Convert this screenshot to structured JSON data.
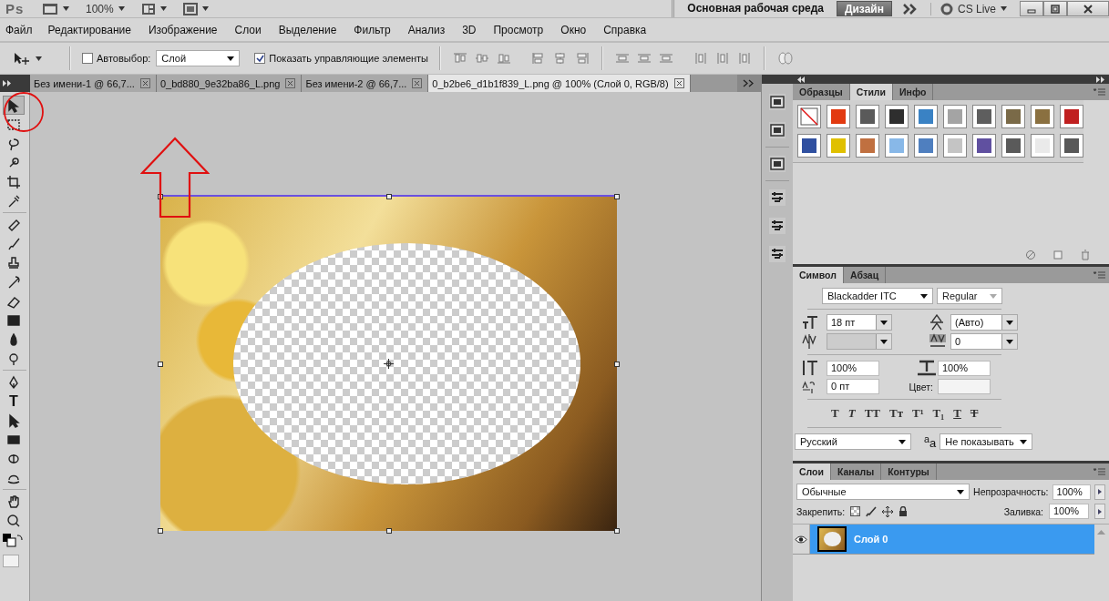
{
  "app_bar": {
    "logo": "Ps",
    "zoom": "100%",
    "workspace": "Основная рабочая среда",
    "design_button": "Дизайн",
    "cs_live": "CS Live"
  },
  "menu": [
    "Файл",
    "Редактирование",
    "Изображение",
    "Слои",
    "Выделение",
    "Фильтр",
    "Анализ",
    "3D",
    "Просмотр",
    "Окно",
    "Справка"
  ],
  "options_bar": {
    "auto_select": {
      "label": "Автовыбор:",
      "checked": false
    },
    "auto_select_target": "Слой",
    "show_controls": {
      "label": "Показать управляющие элементы",
      "checked": true
    }
  },
  "document_tabs": [
    {
      "label": "Без имени-1 @ 66,7...",
      "selected": false
    },
    {
      "label": "0_bd880_9e32ba86_L.png",
      "selected": false
    },
    {
      "label": "Без имени-2 @ 66,7...",
      "selected": false
    },
    {
      "label": "0_b2be6_d1b1f839_L.png @ 100% (Слой 0, RGB/8)",
      "selected": true
    }
  ],
  "tools": [
    {
      "kind": "move",
      "selected": true
    },
    {
      "kind": "marquee",
      "selected": false
    },
    {
      "kind": "lasso",
      "selected": false
    },
    {
      "kind": "quick-select",
      "selected": false
    },
    {
      "kind": "crop",
      "selected": false
    },
    {
      "kind": "eyedropper",
      "selected": false
    },
    {
      "kind": "healing",
      "selected": false
    },
    {
      "kind": "brush",
      "selected": false
    },
    {
      "kind": "stamp",
      "selected": false
    },
    {
      "kind": "history-brush",
      "selected": false
    },
    {
      "kind": "eraser",
      "selected": false
    },
    {
      "kind": "gradient",
      "selected": false
    },
    {
      "kind": "blur",
      "selected": false
    },
    {
      "kind": "dodge",
      "selected": false
    },
    {
      "kind": "pen",
      "selected": false
    },
    {
      "kind": "type",
      "selected": false,
      "glyph": "T"
    },
    {
      "kind": "path-select",
      "selected": false
    },
    {
      "kind": "rectangle",
      "selected": false
    },
    {
      "kind": "rotate-3d",
      "selected": false
    },
    {
      "kind": "orbit-3d",
      "selected": false
    },
    {
      "kind": "hand",
      "selected": false
    },
    {
      "kind": "zoom",
      "selected": false
    }
  ],
  "styles_panel": {
    "tabs": [
      {
        "label": "Образцы",
        "selected": false
      },
      {
        "label": "Стили",
        "selected": true
      },
      {
        "label": "Инфо",
        "selected": false
      }
    ],
    "swatches": [
      {
        "kind": "none"
      },
      {
        "kind": "fill",
        "color": "#e23a10"
      },
      {
        "kind": "fill",
        "color": "#5a5a5a"
      },
      {
        "kind": "fill",
        "color": "#2e2e2e"
      },
      {
        "kind": "fill",
        "color": "#3a82c4"
      },
      {
        "kind": "fill",
        "color": "#a4a4a4"
      },
      {
        "kind": "fill",
        "color": "#5e5e5e"
      },
      {
        "kind": "fill",
        "color": "#7a6a48"
      },
      {
        "kind": "fill",
        "color": "#8a7040"
      },
      {
        "kind": "fill",
        "color": "#c02020"
      },
      {
        "kind": "fill",
        "color": "#3050a0"
      },
      {
        "kind": "fill",
        "color": "#e0c000"
      },
      {
        "kind": "fill",
        "color": "#c07040"
      },
      {
        "kind": "fill",
        "color": "#88b8e8"
      },
      {
        "kind": "fill",
        "color": "#4f7fbf"
      },
      {
        "kind": "fill",
        "color": "#c4c4c4"
      },
      {
        "kind": "fill",
        "color": "#6050a0"
      },
      {
        "kind": "fill",
        "color": "#5a5a5a"
      },
      {
        "kind": "fill",
        "color": "#eaeaea"
      },
      {
        "kind": "fill",
        "color": "#585858"
      }
    ]
  },
  "character_panel": {
    "tabs": [
      {
        "label": "Символ",
        "selected": true
      },
      {
        "label": "Абзац",
        "selected": false
      }
    ],
    "font_family": "Blackadder ITC",
    "font_style": "Regular",
    "font_size": "18 пт",
    "leading": "(Авто)",
    "tracking": "0",
    "vertical_scale": "100%",
    "horizontal_scale": "100%",
    "baseline_shift": "0 пт",
    "color_label": "Цвет:",
    "style_buttons": [
      {
        "kind": "bold",
        "text": "T"
      },
      {
        "kind": "italic",
        "text": "T"
      },
      {
        "kind": "caps",
        "text": "TT"
      },
      {
        "kind": "small-caps",
        "text": "Tт"
      },
      {
        "kind": "superscript",
        "text": "T¹"
      },
      {
        "kind": "subscript",
        "text": "T₁"
      },
      {
        "kind": "underline",
        "text": "T"
      },
      {
        "kind": "strike",
        "text": "T"
      }
    ],
    "language": "Русский",
    "antialias_icon": "$^{a}$a",
    "antialias": "Не показывать"
  },
  "layers_panel": {
    "tabs": [
      {
        "label": "Слои",
        "selected": true
      },
      {
        "label": "Каналы",
        "selected": false
      },
      {
        "label": "Контуры",
        "selected": false
      }
    ],
    "blend_mode": "Обычные",
    "opacity_label": "Непрозрачность:",
    "opacity": "100%",
    "lock_label": "Закрепить:",
    "fill_label": "Заливка:",
    "fill": "100%",
    "layers": [
      {
        "name": "Слой 0",
        "selected": true,
        "visible": true
      }
    ]
  }
}
